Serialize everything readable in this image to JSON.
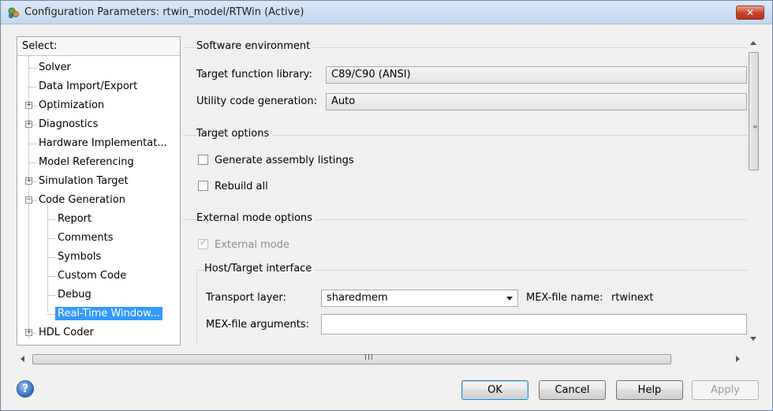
{
  "window": {
    "title": "Configuration Parameters: rtwin_model/RTWin (Active)",
    "close_label": "✕"
  },
  "tree": {
    "header": "Select:",
    "items": [
      {
        "label": "Solver",
        "expander": ""
      },
      {
        "label": "Data Import/Export",
        "expander": ""
      },
      {
        "label": "Optimization",
        "expander": "+"
      },
      {
        "label": "Diagnostics",
        "expander": "+"
      },
      {
        "label": "Hardware Implementat...",
        "expander": ""
      },
      {
        "label": "Model Referencing",
        "expander": ""
      },
      {
        "label": "Simulation Target",
        "expander": "+"
      },
      {
        "label": "Code Generation",
        "expander": "−"
      },
      {
        "label": "Report",
        "expander": ""
      },
      {
        "label": "Comments",
        "expander": ""
      },
      {
        "label": "Symbols",
        "expander": ""
      },
      {
        "label": "Custom Code",
        "expander": ""
      },
      {
        "label": "Debug",
        "expander": ""
      },
      {
        "label": "Real-Time Window...",
        "expander": "",
        "selected": true
      },
      {
        "label": "HDL Coder",
        "expander": "+"
      }
    ]
  },
  "software_env": {
    "title": "Software environment",
    "target_lib_label": "Target function library:",
    "target_lib_value": "C89/C90 (ANSI)",
    "utility_label": "Utility code generation:",
    "utility_value": "Auto"
  },
  "target_options": {
    "title": "Target options",
    "gen_assembly_label": "Generate assembly listings",
    "rebuild_all_label": "Rebuild all"
  },
  "external_mode": {
    "title": "External mode options",
    "external_mode_label": "External mode",
    "external_mode_checked": true,
    "host_target_title": "Host/Target interface",
    "transport_label": "Transport layer:",
    "transport_value": "sharedmem",
    "mex_name_label": "MEX-file name:",
    "mex_name_value": "rtwinext",
    "mex_args_label": "MEX-file arguments:",
    "mex_args_value": ""
  },
  "scrollbar": {
    "grip_h": "III"
  },
  "buttons": {
    "ok": "OK",
    "cancel": "Cancel",
    "help": "Help",
    "apply": "Apply",
    "help_icon": "?"
  },
  "colors": {
    "selection": "#3399ff",
    "close": "#c8452a"
  }
}
